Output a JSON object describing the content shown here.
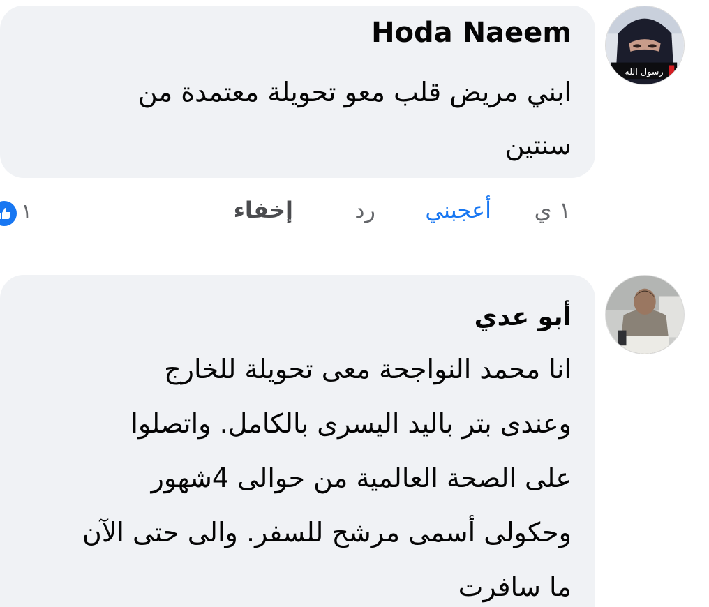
{
  "comments": [
    {
      "author": "Hoda Naeem",
      "lines": [
        "ابني  مريض قلب معو تحويلة معتمدة  من",
        "سنتين"
      ],
      "avatar": "woman-in-niqab-avatar"
    },
    {
      "author": "أبو عدي",
      "lines": [
        "انا  محمد النواجحة معى تحويلة للخارج",
        "وعندى بتر باليد اليسرى بالكامل.  واتصلوا",
        "على الصحة العالمية من حوالى 4شهور",
        "وحكولى أسمى مرشح للسفر.  والى حتى الآن",
        "ما سافرت"
      ],
      "avatar": "man-portrait-avatar"
    }
  ],
  "actions": {
    "time": "١ ي",
    "like": "أعجبني",
    "reply": "رد",
    "hide": "إخفاء"
  },
  "reaction": {
    "icon": "thumbs-up-icon",
    "count": "١"
  },
  "avatar_caption": "رسول الله",
  "colors": {
    "bubble": "#f0f2f5",
    "like": "#1877f2",
    "muted": "#65676b",
    "text": "#050505"
  }
}
